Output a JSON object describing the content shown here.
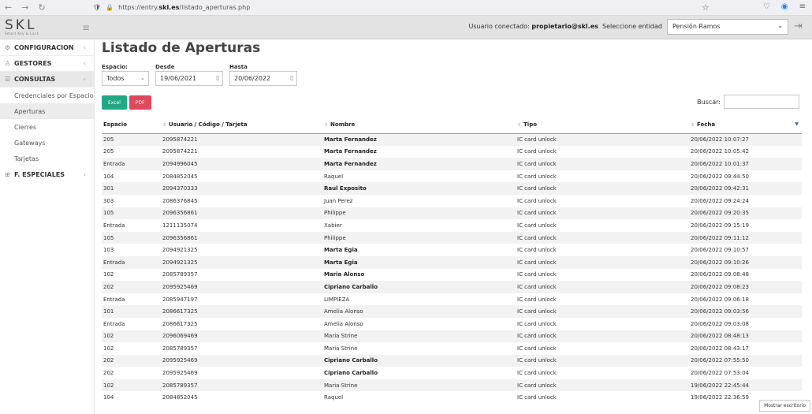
{
  "browser": {
    "url_prefix": "https://entry.",
    "url_domain": "skl.es",
    "url_path": "/listado_aperturas.php"
  },
  "header": {
    "logo": "SKL",
    "logo_sub": "Smart Key & Lock",
    "user_label": "Usuario conectado:",
    "user_email": "propietario@skl.es",
    "entity_label": "Seleccione entidad",
    "entity_value": "Pensión Ramos"
  },
  "sidebar": {
    "groups": [
      {
        "label": "CONFIGURACION",
        "icon": "gear-icon"
      },
      {
        "label": "GESTORES",
        "icon": "user-icon"
      },
      {
        "label": "CONSULTAS",
        "icon": "list-icon"
      }
    ],
    "consultas_items": [
      "Credenciales por Espacio",
      "Aperturas",
      "Cierres",
      "Gateways",
      "Tarjetas"
    ],
    "especiales": "F. ESPECIALES"
  },
  "main": {
    "title": "Listado de Aperturas",
    "espacio_label": "Espacio:",
    "espacio_value": "Todos",
    "desde_label": "Desde",
    "desde_value": "19/06/2021",
    "hasta_label": "Hasta",
    "hasta_value": "20/06/2022",
    "excel_label": "Excel",
    "pdf_label": "PDF",
    "search_label": "Buscar:",
    "columns": [
      "Espacio",
      "Usuario / Código / Tarjeta",
      "Nombre",
      "Tipo",
      "Fecha"
    ],
    "rows": [
      [
        "205",
        "2095874221",
        "Marta Fernandez",
        "IC card unlock",
        "20/06/2022 10:07:27",
        true
      ],
      [
        "205",
        "2095874221",
        "Marta Fernandez",
        "IC card unlock",
        "20/06/2022 10:05:42",
        true
      ],
      [
        "Entrada",
        "2094996045",
        "Marta Fernandez",
        "IC card unlock",
        "20/06/2022 10:01:37",
        true
      ],
      [
        "104",
        "2084852045",
        "Raquel",
        "IC card unlock",
        "20/06/2022 09:44:50",
        false
      ],
      [
        "301",
        "2094370333",
        "Raul Exposito",
        "IC card unlock",
        "20/06/2022 09:42:31",
        true
      ],
      [
        "303",
        "2086376845",
        "Juan Perez",
        "IC card unlock",
        "20/06/2022 09:24:24",
        false
      ],
      [
        "105",
        "2096356861",
        "Philippe",
        "IC card unlock",
        "20/06/2022 09:20:35",
        false
      ],
      [
        "Entrada",
        "1211135074",
        "Xabier",
        "IC card unlock",
        "20/06/2022 09:15:19",
        false
      ],
      [
        "105",
        "2096356861",
        "Philippe",
        "IC card unlock",
        "20/06/2022 09:11:12",
        false
      ],
      [
        "103",
        "2094921325",
        "Marta Egia",
        "IC card unlock",
        "20/06/2022 09:10:57",
        true
      ],
      [
        "Entrada",
        "2094921325",
        "Marta Egia",
        "IC card unlock",
        "20/06/2022 09:10:26",
        true
      ],
      [
        "102",
        "2085789357",
        "Maria  Alonso",
        "IC card unlock",
        "20/06/2022 09:08:48",
        true
      ],
      [
        "202",
        "2095925469",
        "Cipriano Carballo",
        "IC card unlock",
        "20/06/2022 09:08:23",
        true
      ],
      [
        "Entrada",
        "2085947197",
        "LIMPIEZA",
        "IC card unlock",
        "20/06/2022 09:06:18",
        false
      ],
      [
        "101",
        "2086617325",
        "Amelia Alonso",
        "IC card unlock",
        "20/06/2022 09:03:56",
        false
      ],
      [
        "Entrada",
        "2086617325",
        "Amelia Alonso",
        "IC card unlock",
        "20/06/2022 09:03:08",
        false
      ],
      [
        "102",
        "2096069469",
        "Maria Strine",
        "IC card unlock",
        "20/06/2022 08:48:13",
        false
      ],
      [
        "102",
        "2085789357",
        "Maria Strine",
        "IC card unlock",
        "20/06/2022 08:43:17",
        false
      ],
      [
        "202",
        "2095925469",
        "Cipriano Carballo",
        "IC card unlock",
        "20/06/2022 07:55:50",
        true
      ],
      [
        "202",
        "2095925469",
        "Cipriano Carballo",
        "IC card unlock",
        "20/06/2022 07:53:04",
        true
      ],
      [
        "102",
        "2085789357",
        "Maria Strine",
        "IC card unlock",
        "19/06/2022 22:45:44",
        false
      ],
      [
        "104",
        "2084852045",
        "Raquel",
        "IC card unlock",
        "19/06/2022 22:36:59",
        false
      ]
    ]
  },
  "toast": "Mostrar escritorio"
}
